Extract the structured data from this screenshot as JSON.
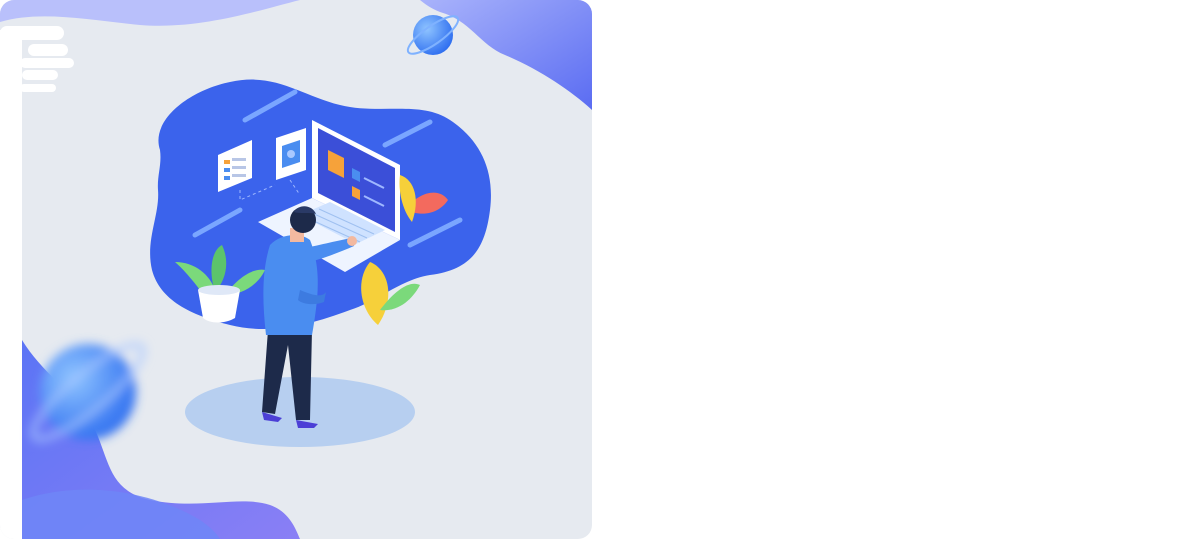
{
  "colors": {
    "page_background": "#ffffff",
    "card_background": "#e6eaf0",
    "accent_blue": "#3d5ef0",
    "accent_purple": "#7a86f5",
    "blob_blue": "#3b63ec",
    "shadow_blue": "#b7cff0",
    "leaf_green": "#7bd97b",
    "leaf_yellow": "#f6d03a",
    "leaf_red": "#f36a5e",
    "shirt_blue": "#4a8df0",
    "pants_navy": "#1d2a4a"
  },
  "illustration": {
    "subject": "person-using-laptop",
    "decor": [
      "planet-icon",
      "planet-icon-blurred",
      "plant-pot",
      "leaf-cluster",
      "floating-card",
      "floating-image-card"
    ]
  }
}
